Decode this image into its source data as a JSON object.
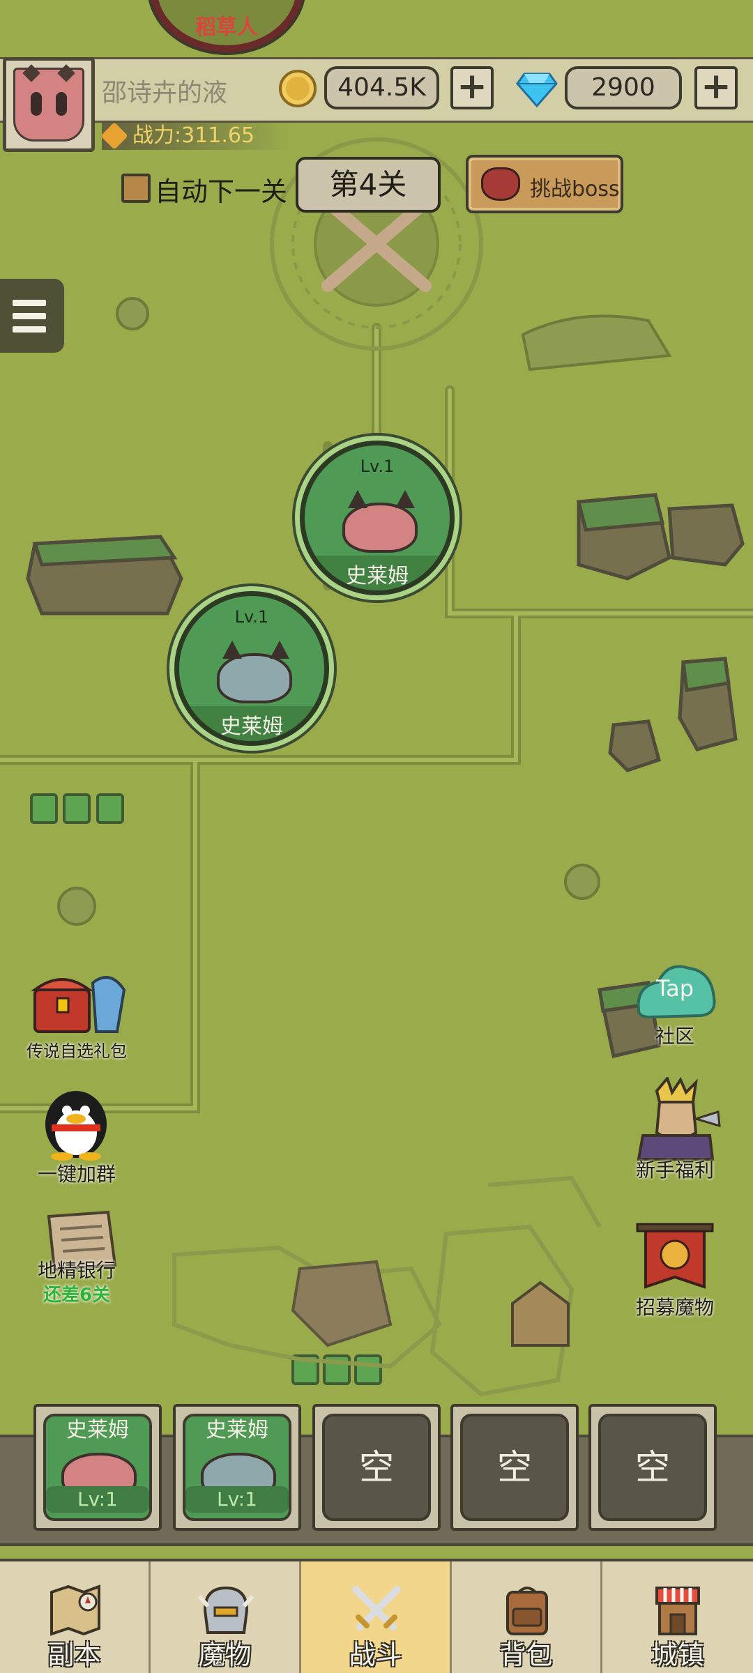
{
  "top_node": {
    "label": "稻草人"
  },
  "header": {
    "player_name": "邵诗卉的液",
    "power": "战力:311.65",
    "gold": "404.5K",
    "gems": "2900",
    "plus": "+"
  },
  "controls": {
    "auto_next_label": "自动下一关",
    "auto_next_checked": false,
    "level": "第4关",
    "boss_button": "挑战boss"
  },
  "nodes": [
    {
      "level": "Lv.1",
      "name": "史莱姆",
      "color": "#d48383"
    },
    {
      "level": "Lv.1",
      "name": "史莱姆",
      "color": "#8fa8ac"
    }
  ],
  "left_features": [
    {
      "label": "传说自选礼包",
      "icon": "treasure-chest-icon"
    },
    {
      "label": "一键加群",
      "icon": "penguin-icon"
    },
    {
      "label": "地精银行",
      "sub": "还差6关",
      "icon": "newspaper-icon"
    }
  ],
  "right_features": [
    {
      "label": "社区",
      "badge": "Tap",
      "icon": "taptap-icon"
    },
    {
      "label": "新手福利",
      "icon": "knight-icon"
    },
    {
      "label": "招募魔物",
      "icon": "banner-icon"
    }
  ],
  "team_slots": [
    {
      "name": "史莱姆",
      "level": "Lv:1",
      "color": "#d48383"
    },
    {
      "name": "史莱姆",
      "level": "Lv:1",
      "color": "#8fa8ac"
    },
    {
      "empty_label": "空"
    },
    {
      "empty_label": "空"
    },
    {
      "empty_label": "空"
    }
  ],
  "bottom_nav": [
    {
      "label": "副本",
      "icon": "map-icon",
      "active": false
    },
    {
      "label": "魔物",
      "icon": "helmet-icon",
      "active": false
    },
    {
      "label": "战斗",
      "icon": "crossed-swords-icon",
      "active": true
    },
    {
      "label": "背包",
      "icon": "backpack-icon",
      "active": false
    },
    {
      "label": "城镇",
      "icon": "shop-icon",
      "active": false
    }
  ],
  "colors": {
    "map_bg": "#9aab4b",
    "node_green": "#4f9a55",
    "power_text": "#f0d36a",
    "bank_sub": "#2fb53a",
    "active_tab": "#f2d68c"
  }
}
